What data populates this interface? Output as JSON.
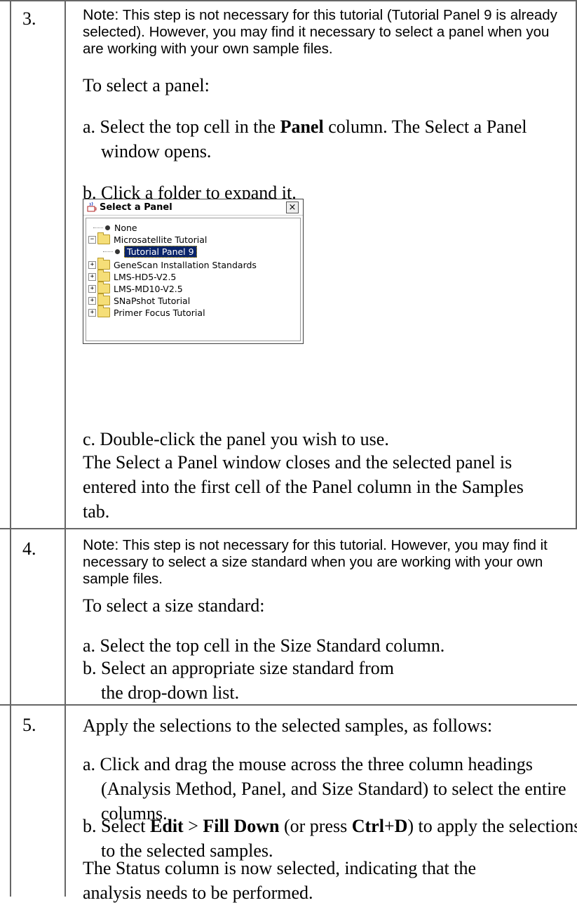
{
  "steps": [
    {
      "number": "3.",
      "note_label": "Note:",
      "note_text": "This step is not necessary for this tutorial (Tutorial Panel 9 is already selected). However, you may find it necessary to select a panel when you are working with your own sample files.",
      "intro": "To select a panel:",
      "a_prefix": "a. Select the top cell in the ",
      "a_bold": "Panel",
      "a_suffix": " column. The Select a Panel window opens.",
      "b": "b. Click a folder to expand it.",
      "c": "c. Double-click the panel you wish to use.",
      "result": "The Select a Panel window closes and the selected panel is entered into the first cell of the Panel column in the Samples tab."
    },
    {
      "number": "4.",
      "note_label": "Note:",
      "note_text": "This step is not necessary for this tutorial. However, you may find it necessary to select a size standard when you are working with your own sample files.",
      "intro": "To select a size standard:",
      "a": "a. Select the top cell in the Size Standard column.",
      "b": "b. Select an appropriate size standard from the drop-down list."
    },
    {
      "number": "5.",
      "intro": "Apply the selections to the selected samples, as follows:",
      "a": "a. Click and drag the mouse across the three column headings (Analysis Method, Panel, and Size Standard) to select the entire columns.",
      "b_1": "b. Select ",
      "b_edit": "Edit",
      "b_2": " > ",
      "b_fill": "Fill Down",
      "b_3": " (or press ",
      "b_ctrl": "Ctrl",
      "b_4": "+",
      "b_d": "D",
      "b_5": ") to apply the selections to the selected samples.",
      "result": "The Status column is now selected, indicating that the analysis needs to be performed."
    }
  ],
  "dialog": {
    "title": "Select a Panel",
    "close": "×",
    "tree": {
      "none": "None",
      "microsatellite": "Microsatellite Tutorial",
      "tutorial_panel": "Tutorial Panel 9",
      "genescan": "GeneScan Installation Standards",
      "lms_hd5": "LMS-HD5-V2.5",
      "lms_md10": "LMS-MD10-V2.5",
      "snapshot": "SNaPshot Tutorial",
      "primer": "Primer Focus Tutorial"
    },
    "expand_plus": "+",
    "expand_minus": "−"
  }
}
